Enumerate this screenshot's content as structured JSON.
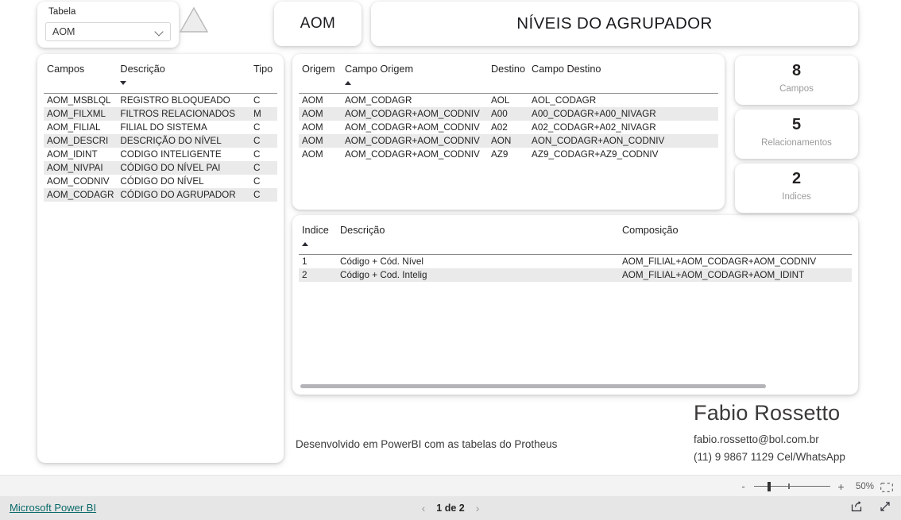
{
  "slicer": {
    "label": "Tabela",
    "value": "AOM",
    "chevron_icon": "chevron-down-icon"
  },
  "header": {
    "table_name": "AOM",
    "title": "NÍVEIS DO AGRUPADOR"
  },
  "fields_table": {
    "columns": [
      "Campos",
      "Descrição",
      "Tipo"
    ],
    "sort_column": "Descrição",
    "sort_direction": "down",
    "rows": [
      [
        "AOM_MSBLQL",
        "REGISTRO BLOQUEADO",
        "C"
      ],
      [
        "AOM_FILXML",
        "FILTROS RELACIONADOS",
        "M"
      ],
      [
        "AOM_FILIAL",
        "FILIAL DO SISTEMA",
        "C"
      ],
      [
        "AOM_DESCRI",
        "DESCRIÇÃO DO NÍVEL",
        "C"
      ],
      [
        "AOM_IDINT",
        "CODIGO INTELIGENTE",
        "C"
      ],
      [
        "AOM_NIVPAI",
        "CÓDIGO DO NÍVEL PAI",
        "C"
      ],
      [
        "AOM_CODNIV",
        "CÓDIGO DO NÍVEL",
        "C"
      ],
      [
        "AOM_CODAGR",
        "CÓDIGO DO AGRUPADOR",
        "C"
      ]
    ]
  },
  "relations_table": {
    "columns": [
      "Origem",
      "Campo Origem",
      "Destino",
      "Campo Destino"
    ],
    "sort_column": "Campo Origem",
    "sort_direction": "up",
    "rows": [
      [
        "AOM",
        "AOM_CODAGR",
        "AOL",
        "AOL_CODAGR"
      ],
      [
        "AOM",
        "AOM_CODAGR+AOM_CODNIV",
        "A00",
        "A00_CODAGR+A00_NIVAGR"
      ],
      [
        "AOM",
        "AOM_CODAGR+AOM_CODNIV",
        "A02",
        "A02_CODAGR+A02_NIVAGR"
      ],
      [
        "AOM",
        "AOM_CODAGR+AOM_CODNIV",
        "AON",
        "AON_CODAGR+AON_CODNIV"
      ],
      [
        "AOM",
        "AOM_CODAGR+AOM_CODNIV",
        "AZ9",
        "AZ9_CODAGR+AZ9_CODNIV"
      ]
    ]
  },
  "index_table": {
    "columns": [
      "Indice",
      "Descrição",
      "Composição"
    ],
    "sort_column": "Indice",
    "sort_direction": "up",
    "rows": [
      [
        "1",
        "Código + Cód. Nível",
        "AOM_FILIAL+AOM_CODAGR+AOM_CODNIV"
      ],
      [
        "2",
        "Código + Cod. Intelig",
        "AOM_FILIAL+AOM_CODAGR+AOM_IDINT"
      ]
    ]
  },
  "kpis": [
    {
      "value": "8",
      "label": "Campos"
    },
    {
      "value": "5",
      "label": "Relacionamentos"
    },
    {
      "value": "2",
      "label": "Indices"
    }
  ],
  "footer": {
    "dev_note": "Desenvolvido em PowerBI com as tabelas do Protheus",
    "author_name": "Fabio Rossetto",
    "author_email": "fabio.rossetto@bol.com.br",
    "author_phone": "(11) 9 9867 1129 Cel/WhatsApp"
  },
  "zoom_bar": {
    "minus": "-",
    "plus": "+",
    "percent": "50%",
    "fit_icon": "fit-to-page-icon"
  },
  "status_bar": {
    "link": "Microsoft Power BI",
    "prev_icon": "chevron-left-icon",
    "next_icon": "chevron-right-icon",
    "page_indicator": "1 de 2",
    "share_icon": "share-icon",
    "fullscreen_icon": "fullscreen-icon"
  },
  "colors": {
    "accent_link": "#0b6a6a",
    "alt_row": "#eaeaea",
    "rule": "#8a8886",
    "triangle_fill": "#ededed",
    "triangle_stroke": "#b8b8b8"
  }
}
